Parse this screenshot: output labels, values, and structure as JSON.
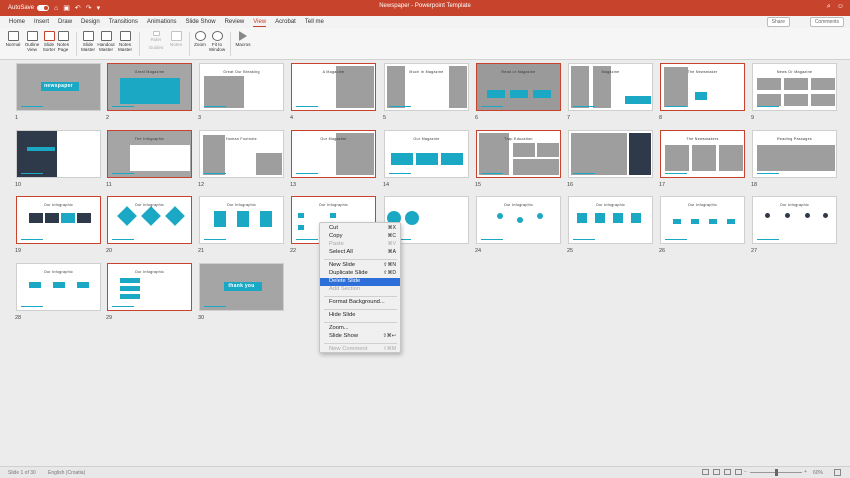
{
  "app": {
    "autosave_label": "AutoSave",
    "autosave_state": "ON",
    "doc_title": "Newspaper - Powerpoint Template",
    "search_icon": "search-icon",
    "smiley_icon": "smiley-icon"
  },
  "ribbon_tabs": [
    "Home",
    "Insert",
    "Draw",
    "Design",
    "Transitions",
    "Animations",
    "Slide Show",
    "Review",
    "View",
    "Acrobat",
    "Tell me"
  ],
  "active_tab": "View",
  "share_label": "Share",
  "comments_label": "Comments",
  "toolbar": {
    "normal": "Normal",
    "outline_view": "Outline View",
    "slide_sorter": "Slide Sorter",
    "notes_page": "Notes Page",
    "slide_master": "Slide Master",
    "handout_master": "Handout Master",
    "notes_master": "Notes Master",
    "ruler": "Ruler",
    "guides": "Guides",
    "notes": "Notes",
    "zoom": "Zoom",
    "fit_to_window": "Fit to Window",
    "macros": "Macros"
  },
  "slides": [
    {
      "n": "1",
      "title": "newspaper"
    },
    {
      "n": "2",
      "title": "Great Magazine"
    },
    {
      "n": "3",
      "title": "Great Our Breaking"
    },
    {
      "n": "4",
      "title": "A Magazine"
    },
    {
      "n": "5",
      "title": "Much In Magazine"
    },
    {
      "n": "6",
      "title": "Read or Magazine"
    },
    {
      "n": "7",
      "title": "Magazine"
    },
    {
      "n": "8",
      "title": "The Newsmaker"
    },
    {
      "n": "9",
      "title": "News Or Magazine"
    },
    {
      "n": "10",
      "title": ""
    },
    {
      "n": "11",
      "title": "The Infographic"
    },
    {
      "n": "12",
      "title": "Human Footnote"
    },
    {
      "n": "13",
      "title": "Our Magazine"
    },
    {
      "n": "14",
      "title": "Our Magazine"
    },
    {
      "n": "15",
      "title": "Trap Education"
    },
    {
      "n": "16",
      "title": ""
    },
    {
      "n": "17",
      "title": "The Newsmakers"
    },
    {
      "n": "18",
      "title": "Reading Passages"
    },
    {
      "n": "19",
      "title": "Our Infographic"
    },
    {
      "n": "20",
      "title": "Our Infographic"
    },
    {
      "n": "21",
      "title": "Our Infographic"
    },
    {
      "n": "22",
      "title": "Our Infographic"
    },
    {
      "n": "23",
      "title": ""
    },
    {
      "n": "24",
      "title": "Our Infographic"
    },
    {
      "n": "25",
      "title": "Our Infographic"
    },
    {
      "n": "26",
      "title": "Our Infographic"
    },
    {
      "n": "27",
      "title": "Our Infographic"
    },
    {
      "n": "28",
      "title": "Our Infographic"
    },
    {
      "n": "29",
      "title": "Our Infographic"
    },
    {
      "n": "30",
      "title": "thank you"
    }
  ],
  "selected_slides": [
    "2",
    "4",
    "6",
    "8",
    "11",
    "13",
    "15",
    "17",
    "19",
    "20",
    "22",
    "29"
  ],
  "context_menu": {
    "items": [
      {
        "label": "Cut",
        "shortcut": "⌘X",
        "disabled": false
      },
      {
        "label": "Copy",
        "shortcut": "⌘C",
        "disabled": false
      },
      {
        "label": "Paste",
        "shortcut": "⌘V",
        "disabled": true
      },
      {
        "label": "Select All",
        "shortcut": "⌘A",
        "disabled": false
      },
      {
        "label": "New Slide",
        "shortcut": "⇧⌘N",
        "disabled": false
      },
      {
        "label": "Duplicate Slide",
        "shortcut": "⇧⌘D",
        "disabled": false
      },
      {
        "label": "Delete Slide",
        "shortcut": "",
        "disabled": false,
        "highlighted": true
      },
      {
        "label": "Add Section",
        "shortcut": "",
        "disabled": true
      },
      {
        "label": "Format Background...",
        "shortcut": "",
        "disabled": false
      },
      {
        "label": "Hide Slide",
        "shortcut": "",
        "disabled": false
      },
      {
        "label": "Zoom...",
        "shortcut": "",
        "disabled": false
      },
      {
        "label": "Slide Show",
        "shortcut": "⇧⌘↩",
        "disabled": false
      },
      {
        "label": "New Comment",
        "shortcut": "⇧⌘M",
        "disabled": true
      }
    ]
  },
  "status": {
    "slide_info": "Slide 1 of 30",
    "language": "English (Croatia)",
    "zoom": "60%"
  },
  "colors": {
    "accent": "#c8432b",
    "teal": "#1ba8c4",
    "menu_highlight": "#2c6fd8"
  }
}
